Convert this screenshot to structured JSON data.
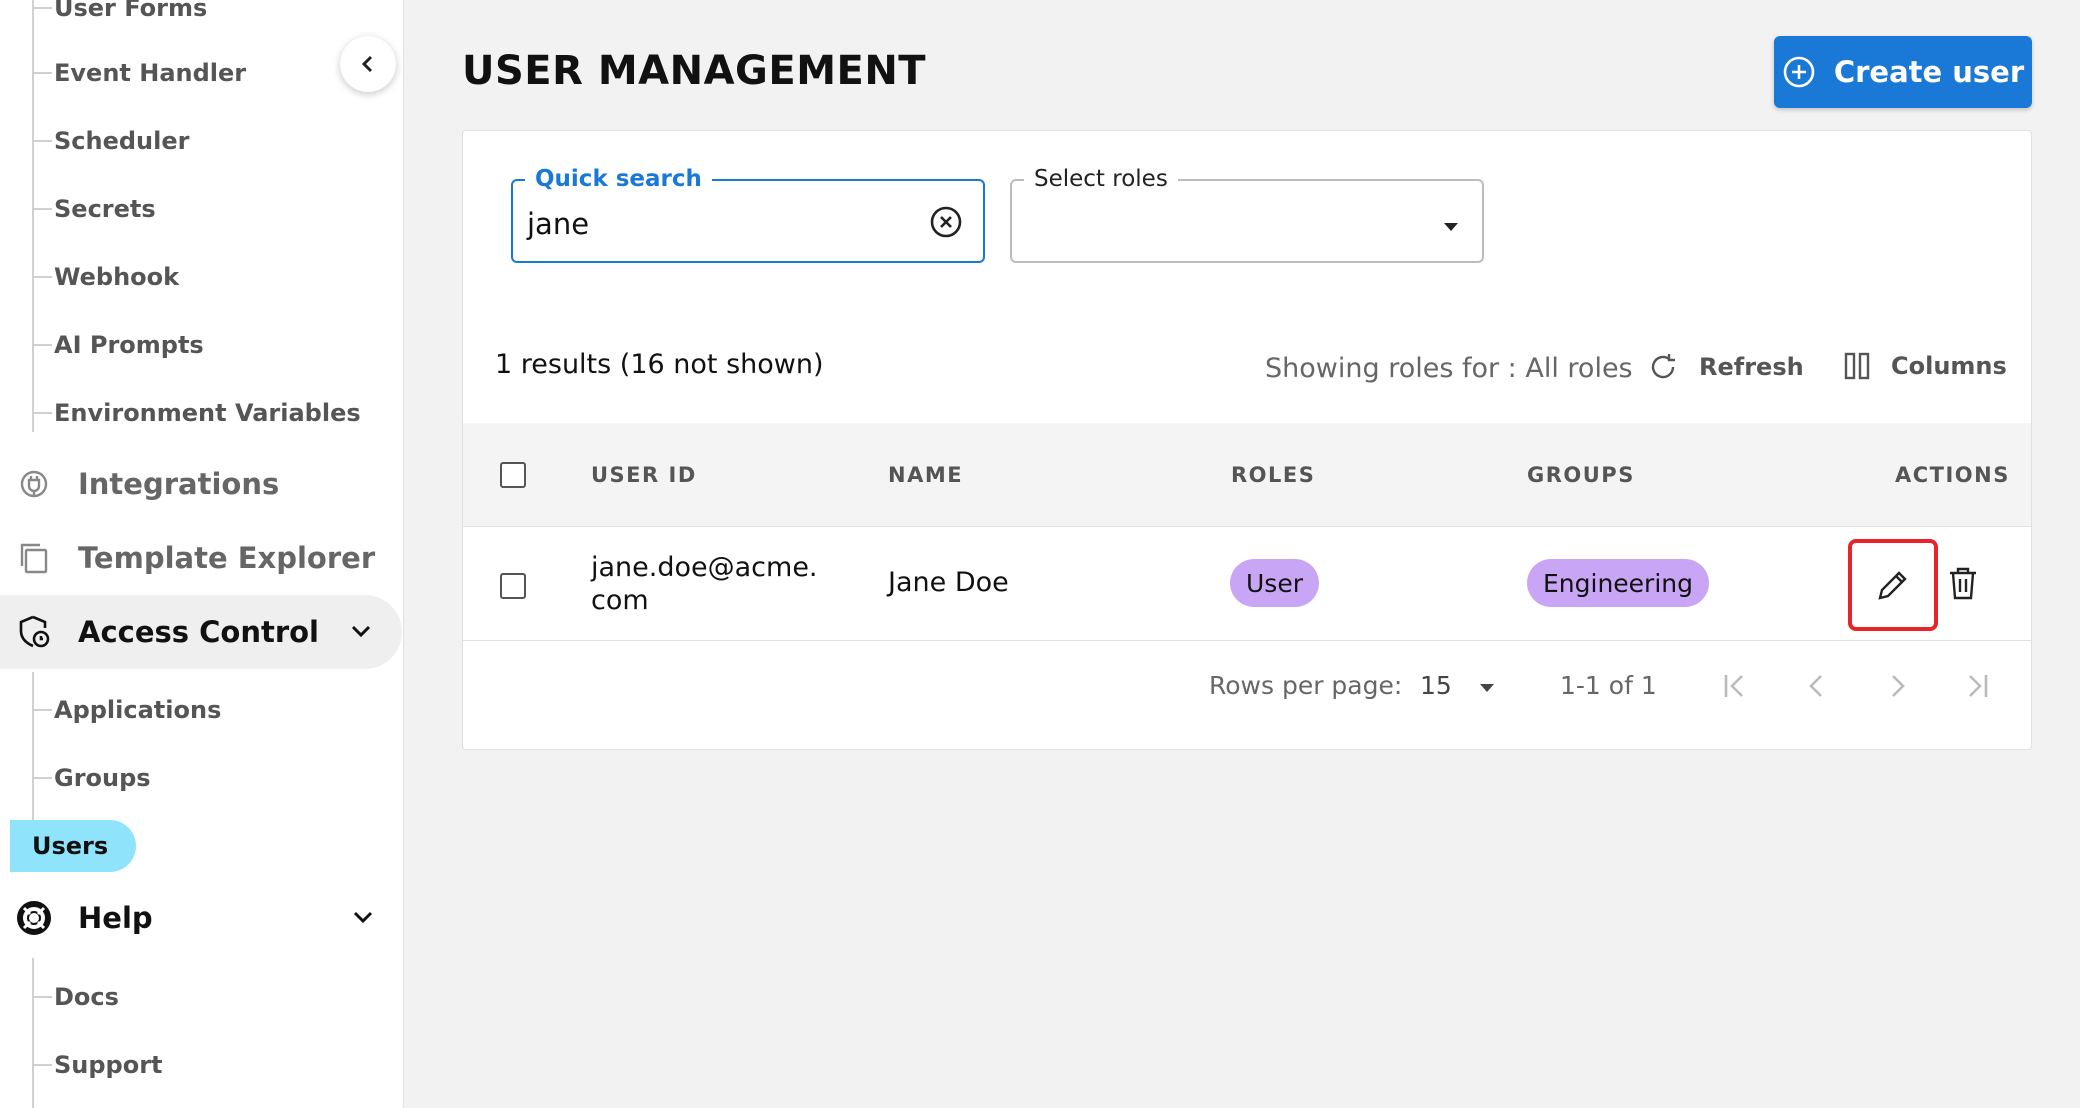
{
  "sidebar": {
    "sub_items_top": [
      "User Forms",
      "Event Handler",
      "Scheduler",
      "Secrets",
      "Webhook",
      "AI Prompts",
      "Environment Variables"
    ],
    "integrations": "Integrations",
    "template_explorer": "Template Explorer",
    "access_control": "Access Control",
    "access_items": [
      "Applications",
      "Groups",
      "Users"
    ],
    "help": "Help",
    "help_items": [
      "Docs",
      "Support"
    ]
  },
  "header": {
    "title": "USER MANAGEMENT",
    "create_label": "Create user"
  },
  "filters": {
    "search_label": "Quick search",
    "search_value": "jane",
    "roles_label": "Select roles",
    "roles_value": ""
  },
  "toolbar": {
    "results": "1 results (16 not shown)",
    "roles_for": "Showing roles for : All roles",
    "refresh": "Refresh",
    "columns": "Columns"
  },
  "table": {
    "headers": [
      "USER ID",
      "NAME",
      "ROLES",
      "GROUPS",
      "ACTIONS"
    ],
    "rows": [
      {
        "user_id": "jane.doe@acme.com",
        "name": "Jane Doe",
        "role": "User",
        "group": "Engineering"
      }
    ]
  },
  "pagination": {
    "rows_label": "Rows per page:",
    "rows_value": "15",
    "range": "1-1 of 1"
  },
  "colors": {
    "accent": "#1a78d6",
    "active_nav": "#8fe3fb",
    "chip": "#c9a6f5",
    "highlight": "#e8232a"
  }
}
